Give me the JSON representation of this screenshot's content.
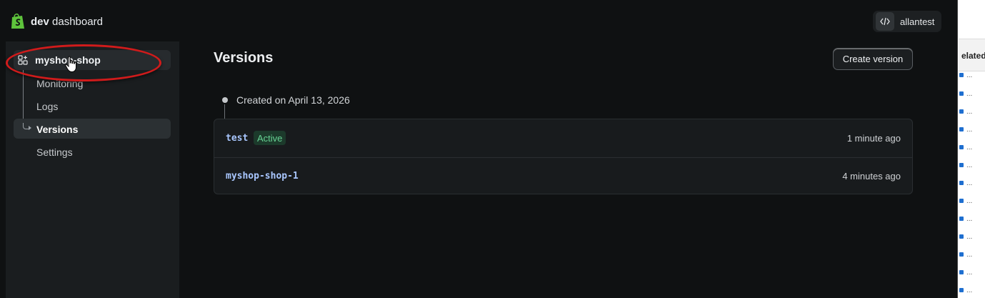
{
  "brand": {
    "bold": "dev",
    "rest": "dashboard",
    "brand_color": "#5ec33c"
  },
  "user": {
    "name": "allantest",
    "icon": "code-icon"
  },
  "sidebar": {
    "app_name": "myshop-shop",
    "app_icon": "apps-grid-icon",
    "items": [
      {
        "label": "Monitoring"
      },
      {
        "label": "Logs"
      },
      {
        "label": "Versions",
        "active": true
      },
      {
        "label": "Settings"
      }
    ]
  },
  "main": {
    "title": "Versions",
    "create_button": "Create version",
    "timeline_label": "Created on April 13, 2026",
    "versions": [
      {
        "name": "test",
        "badge": "Active",
        "time": "1 minute ago"
      },
      {
        "name": "myshop-shop-1",
        "badge": "",
        "time": "4 minutes ago"
      }
    ]
  },
  "background_window": {
    "header_text": "elated",
    "row_text": "..."
  },
  "colors": {
    "accent_badge": "#67d394",
    "annotation_ellipse": "#d01b1b",
    "version_name": "#a9c7ff"
  }
}
